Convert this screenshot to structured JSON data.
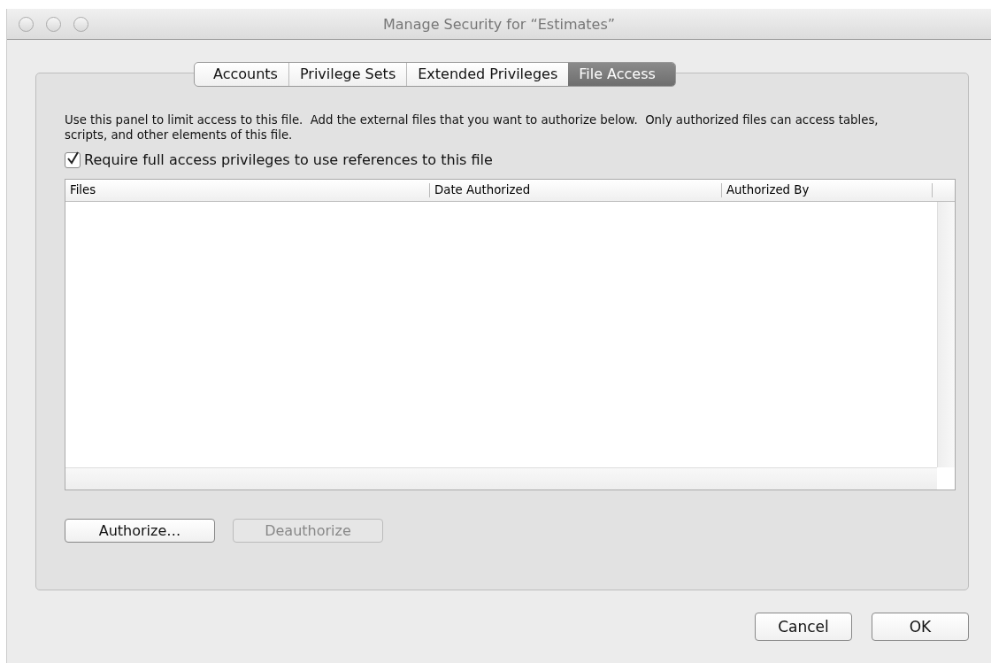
{
  "window": {
    "title": "Manage Security for “Estimates”"
  },
  "tabs": [
    {
      "label": "Accounts",
      "selected": false
    },
    {
      "label": "Privilege Sets",
      "selected": false
    },
    {
      "label": "Extended Privileges",
      "selected": false
    },
    {
      "label": "File Access",
      "selected": true
    }
  ],
  "description": "Use this panel to limit access to this file.  Add the external files that you want to authorize below.  Only authorized files can access tables, scripts, and other elements of this file.",
  "require_full_access": {
    "label": "Require full access privileges to use references to this file",
    "checked": true
  },
  "table": {
    "columns": [
      "Files",
      "Date Authorized",
      "Authorized By"
    ]
  },
  "panel_buttons": [
    {
      "label": "Authorize…",
      "disabled": false
    },
    {
      "label": "Deauthorize",
      "disabled": true
    }
  ],
  "buttons": [
    "Cancel",
    "OK"
  ]
}
